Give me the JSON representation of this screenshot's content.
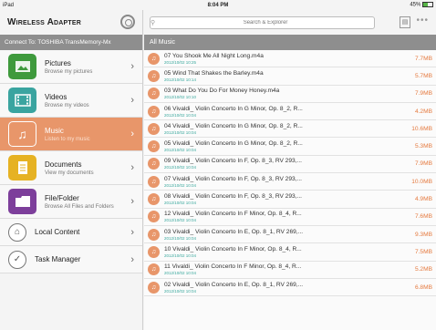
{
  "status_bar": {
    "carrier": "iPad",
    "time": "8:04 PM",
    "battery": "45%"
  },
  "app": {
    "title": "Wireless Adapter"
  },
  "connection": {
    "text": "Connect To: TOSHIBA  TransMemory-Mx"
  },
  "sidebar": {
    "items": [
      {
        "label": "Pictures",
        "sub": "Browse my pictures",
        "icon": "picture-icon",
        "color": "#3f9a3d"
      },
      {
        "label": "Videos",
        "sub": "Browse my videos",
        "icon": "video-icon",
        "color": "#3aa4a0"
      },
      {
        "label": "Music",
        "sub": "Listen to my music",
        "icon": "music-icon",
        "color": "#e8966a",
        "active": true
      },
      {
        "label": "Documents",
        "sub": "View my documents",
        "icon": "document-icon",
        "color": "#e6b223"
      },
      {
        "label": "File/Folder",
        "sub": "Browse All Files and Folders",
        "icon": "folder-icon",
        "color": "#7d3f9b"
      },
      {
        "label": "Local Content",
        "sub": "",
        "icon": "lock-icon"
      },
      {
        "label": "Task Manager",
        "sub": "",
        "icon": "check-icon"
      }
    ]
  },
  "search": {
    "placeholder": "Search & Explorer"
  },
  "breadcrumb": "All Music",
  "files": [
    {
      "name": "07 You Shook Me All Night Long.m4a",
      "date": "2012/10/02 10:25",
      "size": "7.7MB"
    },
    {
      "name": "05 Wind That Shakes the Barley.m4a",
      "date": "2012/10/02 10:14",
      "size": "5.7MB"
    },
    {
      "name": "03 What Do You Do For Money Honey.m4a",
      "date": "2012/10/02 10:10",
      "size": "7.9MB"
    },
    {
      "name": "06 Vivaldi_ Violin Concerto In G Minor, Op. 8_2, R...",
      "date": "2012/10/02 10:04",
      "size": "4.2MB"
    },
    {
      "name": "04 Vivaldi_ Violin Concerto In G Minor, Op. 8_2, R...",
      "date": "2012/10/02 10:04",
      "size": "10.6MB"
    },
    {
      "name": "05 Vivaldi_ Violin Concerto In G Minor, Op. 8_2, R...",
      "date": "2012/10/02 10:04",
      "size": "5.3MB"
    },
    {
      "name": "09 Vivaldi_ Violin Concerto In F, Op. 8_3, RV 293,...",
      "date": "2012/10/02 10:04",
      "size": "7.9MB"
    },
    {
      "name": "07 Vivaldi_ Violin Concerto In F, Op. 8_3, RV 293,...",
      "date": "2012/10/02 10:04",
      "size": "10.0MB"
    },
    {
      "name": "08 Vivaldi_ Violin Concerto In F, Op. 8_3, RV 293,...",
      "date": "2012/10/02 10:04",
      "size": "4.9MB"
    },
    {
      "name": "12 Vivaldi_ Violin Concerto In F Minor, Op. 8_4, R...",
      "date": "2012/10/02 10:04",
      "size": "7.6MB"
    },
    {
      "name": "03 Vivaldi_ Violin Concerto In E, Op. 8_1, RV 269,...",
      "date": "2012/10/02 10:04",
      "size": "9.3MB"
    },
    {
      "name": "10 Vivaldi_ Violin Concerto In F Minor, Op. 8_4, R...",
      "date": "2012/10/02 10:04",
      "size": "7.5MB"
    },
    {
      "name": "11 Vivaldi_ Violin Concerto In F Minor, Op. 8_4, R...",
      "date": "2012/10/02 10:04",
      "size": "5.2MB"
    },
    {
      "name": "02 Vivaldi_ Violin Concerto In E, Op. 8_1, RV 269,...",
      "date": "2012/10/02 10:04",
      "size": "6.8MB"
    }
  ]
}
